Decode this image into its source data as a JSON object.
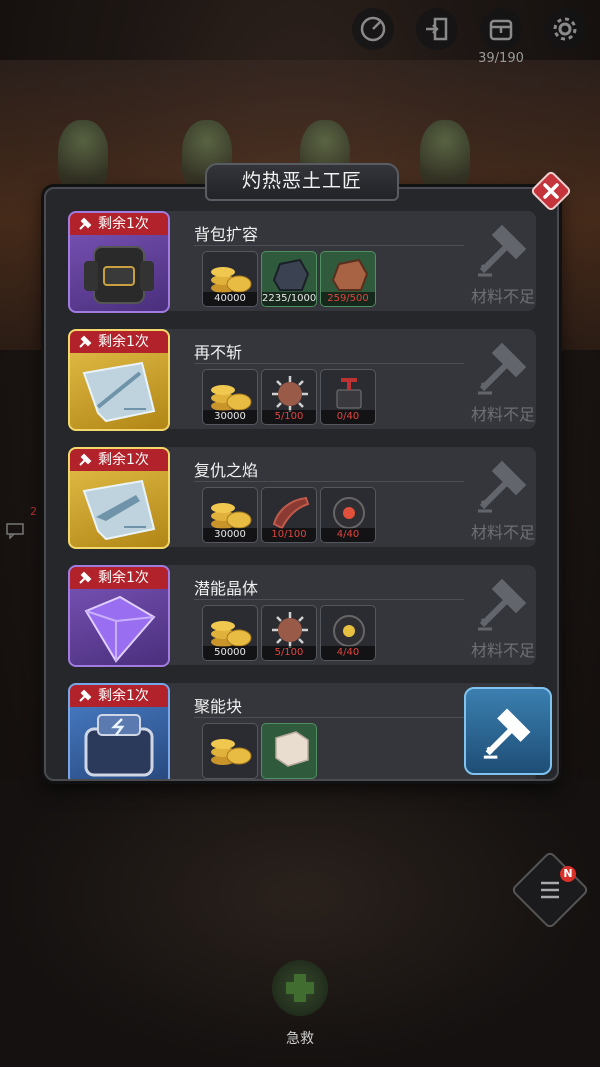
{
  "topbar": {
    "icons": [
      "speed-icon",
      "exit-door-icon",
      "backpack-icon",
      "gear-icon"
    ],
    "bag_count": "39/190"
  },
  "side": {
    "number": "2"
  },
  "dialog": {
    "title": "灼热恶土工匠",
    "recipes": [
      {
        "name": "背包扩容",
        "remain": "剩余1次",
        "rarity": "purple",
        "item_icon": "backpack-item-icon",
        "materials": [
          {
            "icon": "gold-coins-icon",
            "count": "40000",
            "insufficient": false,
            "bg": "neutral"
          },
          {
            "icon": "dark-ore-icon",
            "count": "2235/1000",
            "insufficient": false,
            "bg": "green"
          },
          {
            "icon": "copper-ore-icon",
            "count": "259/500",
            "insufficient": true,
            "bg": "green"
          }
        ],
        "craft_label": "材料不足",
        "craftable": false
      },
      {
        "name": "再不斩",
        "remain": "剩余1次",
        "rarity": "gold",
        "item_icon": "blade-blueprint-icon",
        "materials": [
          {
            "icon": "gold-coins-icon",
            "count": "30000",
            "insufficient": false,
            "bg": "neutral"
          },
          {
            "icon": "spiked-ball-icon",
            "count": "5/100",
            "insufficient": true,
            "bg": "neutral"
          },
          {
            "icon": "detonator-icon",
            "count": "0/40",
            "insufficient": true,
            "bg": "neutral"
          }
        ],
        "craft_label": "材料不足",
        "craftable": false
      },
      {
        "name": "复仇之焰",
        "remain": "剩余1次",
        "rarity": "gold",
        "item_icon": "gun-blueprint-icon",
        "materials": [
          {
            "icon": "gold-coins-icon",
            "count": "30000",
            "insufficient": false,
            "bg": "neutral"
          },
          {
            "icon": "red-claw-icon",
            "count": "10/100",
            "insufficient": true,
            "bg": "neutral"
          },
          {
            "icon": "bomb-core-icon",
            "count": "4/40",
            "insufficient": true,
            "bg": "neutral"
          }
        ],
        "craft_label": "材料不足",
        "craftable": false
      },
      {
        "name": "潜能晶体",
        "remain": "剩余1次",
        "rarity": "purple",
        "item_icon": "purple-crystal-icon",
        "materials": [
          {
            "icon": "gold-coins-icon",
            "count": "50000",
            "insufficient": false,
            "bg": "neutral"
          },
          {
            "icon": "spiked-ball-icon",
            "count": "5/100",
            "insufficient": true,
            "bg": "neutral"
          },
          {
            "icon": "bomb-core-icon",
            "count": "4/40",
            "insufficient": true,
            "bg": "neutral"
          }
        ],
        "craft_label": "材料不足",
        "craftable": false
      },
      {
        "name": "聚能块",
        "remain": "剩余1次",
        "rarity": "blue",
        "item_icon": "energy-block-icon",
        "materials": [
          {
            "icon": "gold-coins-icon",
            "count": "",
            "insufficient": false,
            "bg": "neutral"
          },
          {
            "icon": "stone-cube-icon",
            "count": "",
            "insufficient": false,
            "bg": "green"
          }
        ],
        "craft_label": "",
        "craftable": true
      }
    ]
  },
  "bottom": {
    "rescue_label": "急救"
  },
  "colors": {
    "panel": "#26272b",
    "remain_badge": "#b2222a",
    "insufficient": "#e0453e",
    "craft_active": "#3b7fb0"
  }
}
